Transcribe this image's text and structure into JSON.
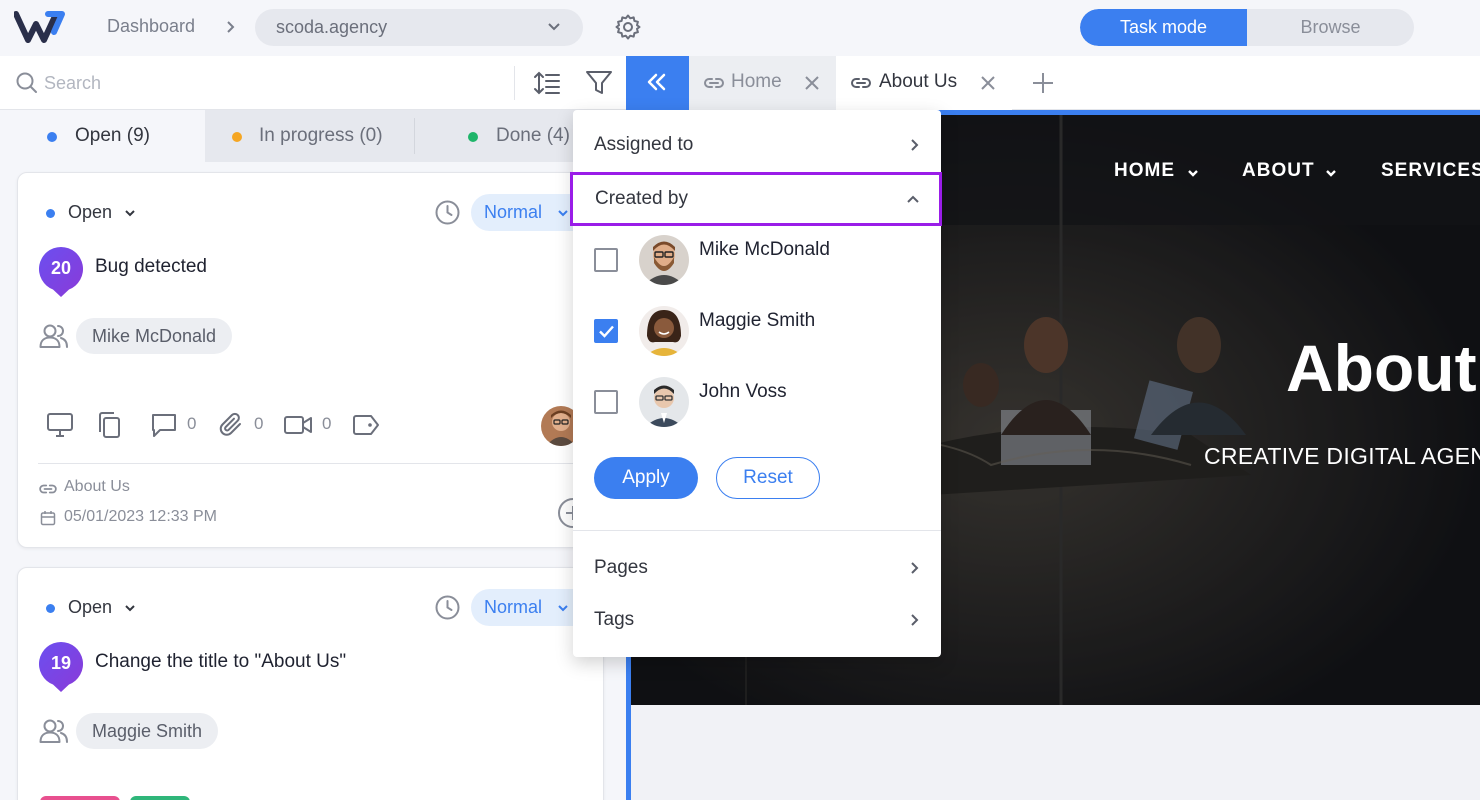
{
  "header": {
    "breadcrumb": "Dashboard",
    "site_select": "scoda.agency",
    "modes": {
      "task": "Task mode",
      "browse": "Browse"
    }
  },
  "toolbar": {
    "search_placeholder": "Search",
    "tabs": [
      {
        "label": "Home",
        "active": false
      },
      {
        "label": "About Us",
        "active": true
      }
    ]
  },
  "status_tabs": [
    {
      "label": "Open (9)",
      "color": "#3b7ff0"
    },
    {
      "label": "In progress (0)",
      "color": "#f5a623"
    },
    {
      "label": "Done (4)",
      "color": "#1fb56a"
    }
  ],
  "tasks": [
    {
      "status": "Open",
      "priority": "Normal",
      "number": "20",
      "title": "Bug detected",
      "assignee": "Mike McDonald",
      "comments": "0",
      "attachments": "0",
      "videos": "0",
      "page": "About Us",
      "date": "05/01/2023 12:33 PM"
    },
    {
      "status": "Open",
      "priority": "Normal",
      "number": "19",
      "title": "Change the title to \"About Us\"",
      "assignee": "Maggie Smith"
    }
  ],
  "preview": {
    "nav": [
      "HOME",
      "ABOUT",
      "SERVICES"
    ],
    "hero_title": "About",
    "hero_subtitle": "CREATIVE DIGITAL AGENC"
  },
  "filter_menu": {
    "assigned_to": "Assigned to",
    "created_by": "Created by",
    "users": [
      {
        "name": "Mike McDonald",
        "checked": false
      },
      {
        "name": "Maggie Smith",
        "checked": true
      },
      {
        "name": "John Voss",
        "checked": false
      }
    ],
    "apply": "Apply",
    "reset": "Reset",
    "pages": "Pages",
    "tags": "Tags"
  },
  "colors": {
    "accent": "#3b7ff0",
    "highlight": "#9a1de8",
    "pin": "#7b3fe4"
  }
}
